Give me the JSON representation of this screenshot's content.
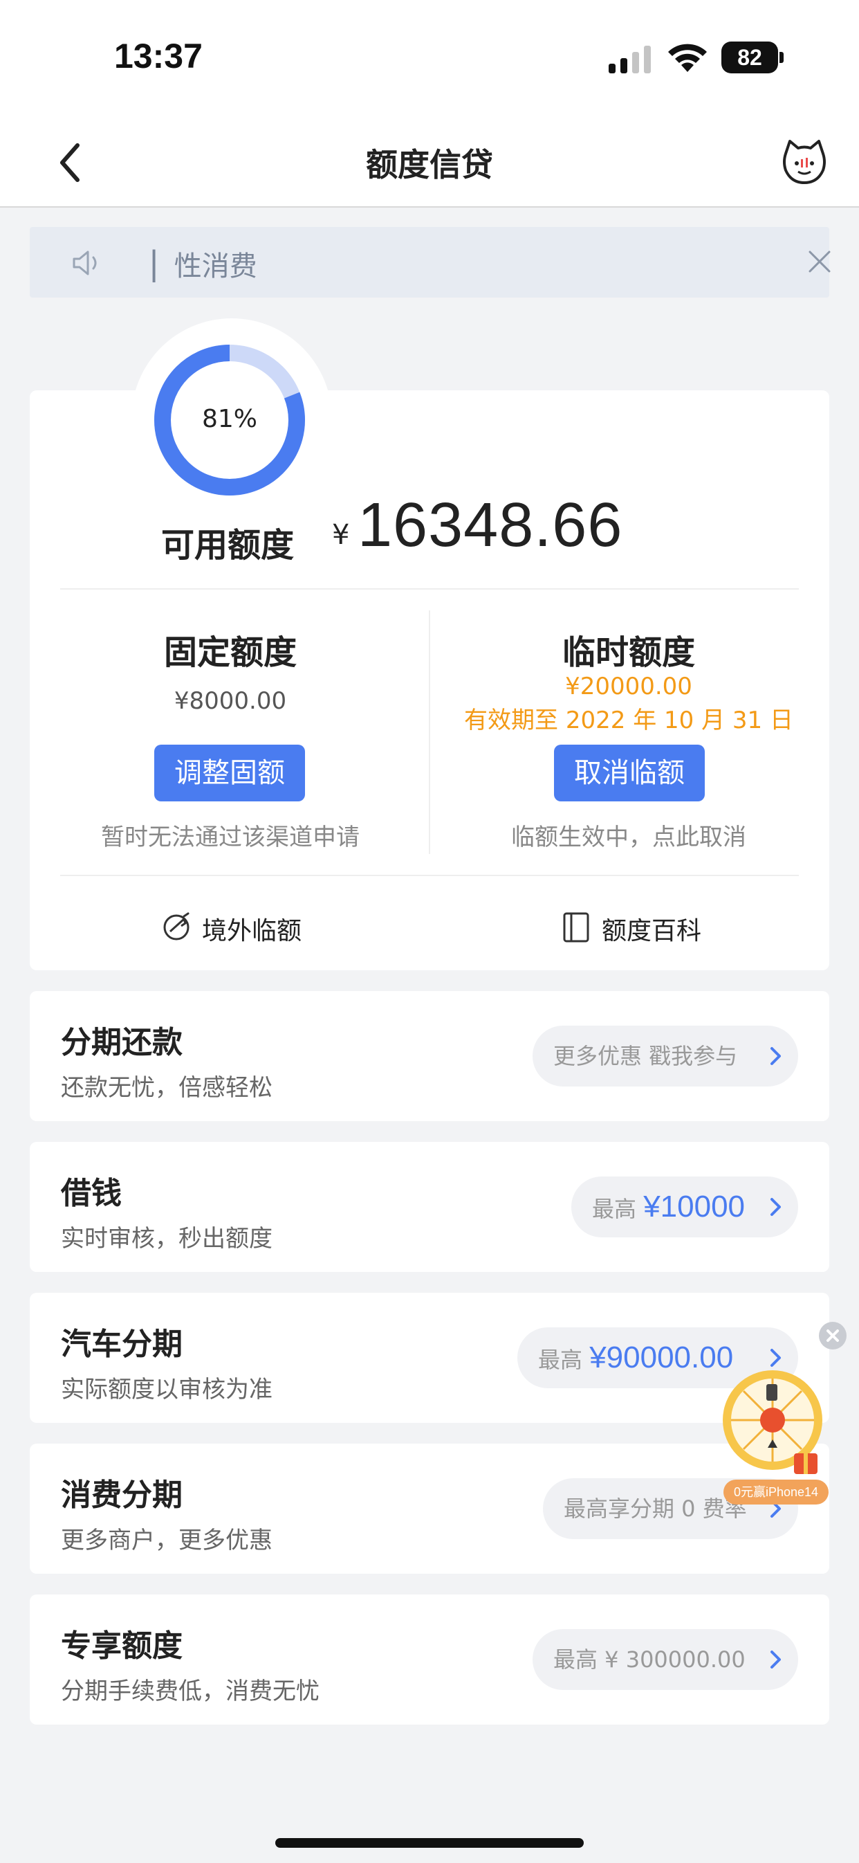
{
  "status_bar": {
    "time": "13:37",
    "battery": "82"
  },
  "nav": {
    "title": "额度信贷"
  },
  "notice": {
    "text": "▏性消费"
  },
  "credit": {
    "usage_percent_label": "81%",
    "usage_fraction": 0.81,
    "available_label": "可用额度",
    "currency": "¥",
    "available_amount": "16348.66",
    "fixed": {
      "title": "固定额度",
      "amount": "¥8000.00",
      "button": "调整固额",
      "note": "暂时无法通过该渠道申请"
    },
    "temporary": {
      "title": "临时额度",
      "amount": "¥20000.00",
      "validity": "有效期至 2022 年 10 月 31 日",
      "button": "取消临额",
      "note": "临额生效中，点此取消"
    },
    "links": [
      {
        "label": "境外临额",
        "icon": "globe-plane-icon"
      },
      {
        "label": "额度百科",
        "icon": "book-icon"
      }
    ]
  },
  "services": [
    {
      "title": "分期还款",
      "subtitle": "还款无忧，倍感轻松",
      "pill_prefix": "更多优惠 戳我参与",
      "pill_value": ""
    },
    {
      "title": "借钱",
      "subtitle": "实时审核，秒出额度",
      "pill_prefix": "最高",
      "pill_value": "¥10000"
    },
    {
      "title": "汽车分期",
      "subtitle": "实际额度以审核为准",
      "pill_prefix": "最高",
      "pill_value": "¥90000.00"
    },
    {
      "title": "消费分期",
      "subtitle": "更多商户，更多优惠",
      "pill_prefix": "最高享分期 0 费率",
      "pill_value": ""
    },
    {
      "title": "专享额度",
      "subtitle": "分期手续费低，消费无忧",
      "pill_prefix": "最高 ¥ 300000.00",
      "pill_value": ""
    }
  ],
  "floating_widget": {
    "label": "0元赢iPhone14"
  },
  "colors": {
    "accent": "#4a7cf0",
    "temp": "#f39a16"
  }
}
